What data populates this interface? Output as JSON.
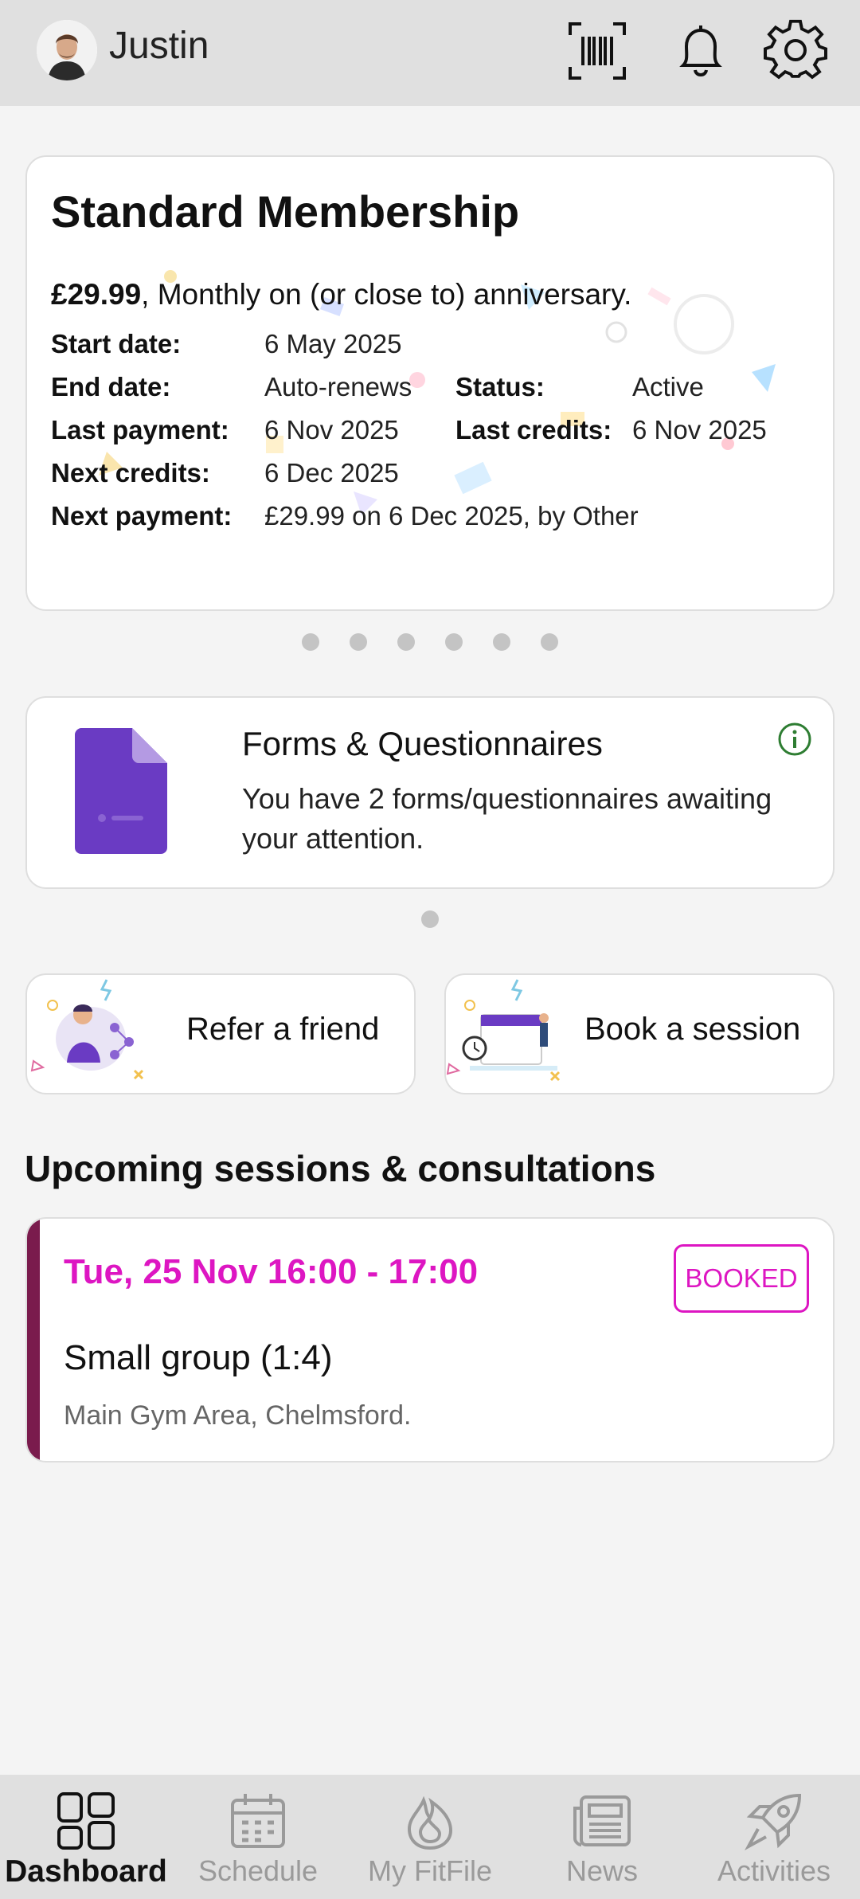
{
  "header": {
    "username": "Justin",
    "icons": [
      "avatar",
      "barcode-icon",
      "bell-icon",
      "gear-icon"
    ]
  },
  "membership": {
    "title": "Standard Membership",
    "price": "£29.99",
    "price_suffix": ", Monthly on (or close to) anniversary.",
    "fields": {
      "start_date_label": "Start date:",
      "start_date": "6 May 2025",
      "end_date_label": "End date:",
      "end_date": "Auto-renews",
      "status_label": "Status:",
      "status": "Active",
      "last_payment_label": "Last payment:",
      "last_payment": "6 Nov 2025",
      "last_credits_label": "Last credits:",
      "last_credits": "6 Nov 2025",
      "next_credits_label": "Next credits:",
      "next_credits": "6 Dec 2025",
      "next_payment_label": "Next payment:",
      "next_payment": "£29.99 on 6 Dec 2025, by Other"
    },
    "carousel_pages": 6,
    "active_page": 1
  },
  "forms": {
    "title": "Forms & Questionnaires",
    "text": "You have 2 forms/questionnaires awaiting your attention.",
    "carousel_pages": 1
  },
  "quick_actions": {
    "refer": "Refer a friend",
    "book": "Book a session"
  },
  "upcoming": {
    "title": "Upcoming sessions & consultations",
    "session": {
      "time": "Tue, 25 Nov 16:00 - 17:00",
      "badge": "BOOKED",
      "name": "Small group (1:4)",
      "location": "Main Gym Area, Chelmsford."
    }
  },
  "nav": {
    "items": [
      {
        "label": "Dashboard",
        "icon": "dashboard-icon",
        "active": true
      },
      {
        "label": "Schedule",
        "icon": "calendar-icon",
        "active": false
      },
      {
        "label": "My FitFile",
        "icon": "flame-icon",
        "active": false
      },
      {
        "label": "News",
        "icon": "newspaper-icon",
        "active": false
      },
      {
        "label": "Activities",
        "icon": "rocket-icon",
        "active": false
      }
    ]
  },
  "colors": {
    "accent": "#dd16c2",
    "session_bar": "#7a1b4d",
    "forms_icon": "#6a3bc3",
    "info_icon": "#2e7d32"
  }
}
